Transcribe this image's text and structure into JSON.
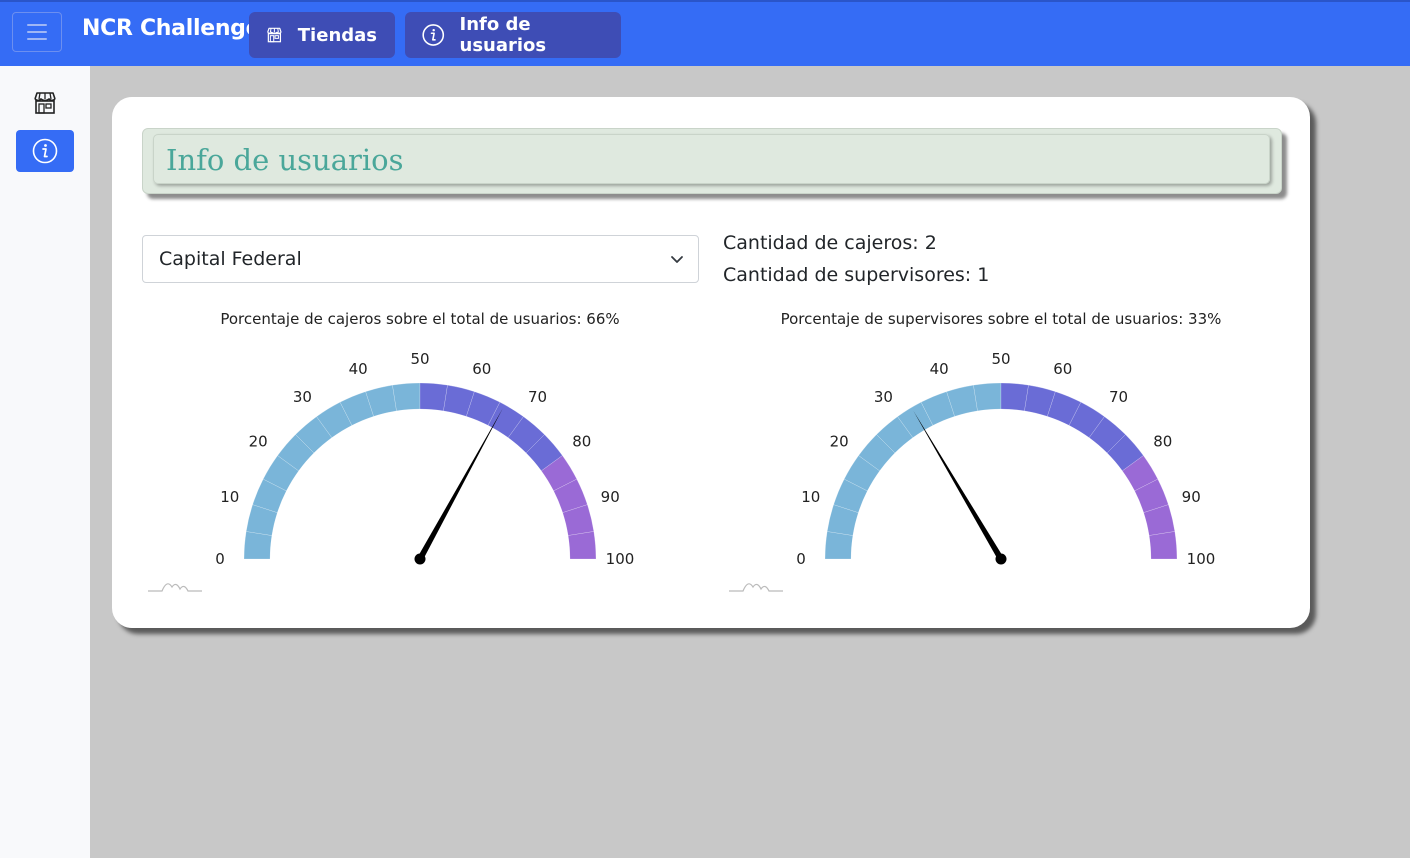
{
  "app": {
    "brand": "NCR Challenge",
    "nav": [
      {
        "label": "Tiendas",
        "icon": "store-icon"
      },
      {
        "label": "Info de usuarios",
        "icon": "info-icon"
      }
    ],
    "accent": "#356cf5"
  },
  "sidebar": {
    "items": [
      {
        "icon": "store-icon",
        "active": false
      },
      {
        "icon": "info-icon",
        "active": true
      }
    ]
  },
  "page": {
    "title": "Info de usuarios",
    "select": {
      "value": "Capital Federal"
    },
    "stats": {
      "cajeros": "Cantidad de cajeros: 2",
      "supervisores": "Cantidad de supervisores: 1"
    }
  },
  "gauges": [
    {
      "title": "Porcentaje de cajeros sobre el total de usuarios: 66%",
      "value": 66,
      "min": 0,
      "max": 100,
      "ticks": [
        0,
        10,
        20,
        30,
        40,
        50,
        60,
        70,
        80,
        90,
        100
      ],
      "bands": [
        {
          "from": 0,
          "to": 50,
          "color": "#7ab5d9"
        },
        {
          "from": 50,
          "to": 80,
          "color": "#6a6cd6"
        },
        {
          "from": 80,
          "to": 100,
          "color": "#9a6ad6"
        }
      ]
    },
    {
      "title": "Porcentaje de supervisores sobre el total de usuarios: 33%",
      "value": 33,
      "min": 0,
      "max": 100,
      "ticks": [
        0,
        10,
        20,
        30,
        40,
        50,
        60,
        70,
        80,
        90,
        100
      ],
      "bands": [
        {
          "from": 0,
          "to": 50,
          "color": "#7ab5d9"
        },
        {
          "from": 50,
          "to": 80,
          "color": "#6a6cd6"
        },
        {
          "from": 80,
          "to": 100,
          "color": "#9a6ad6"
        }
      ]
    }
  ]
}
